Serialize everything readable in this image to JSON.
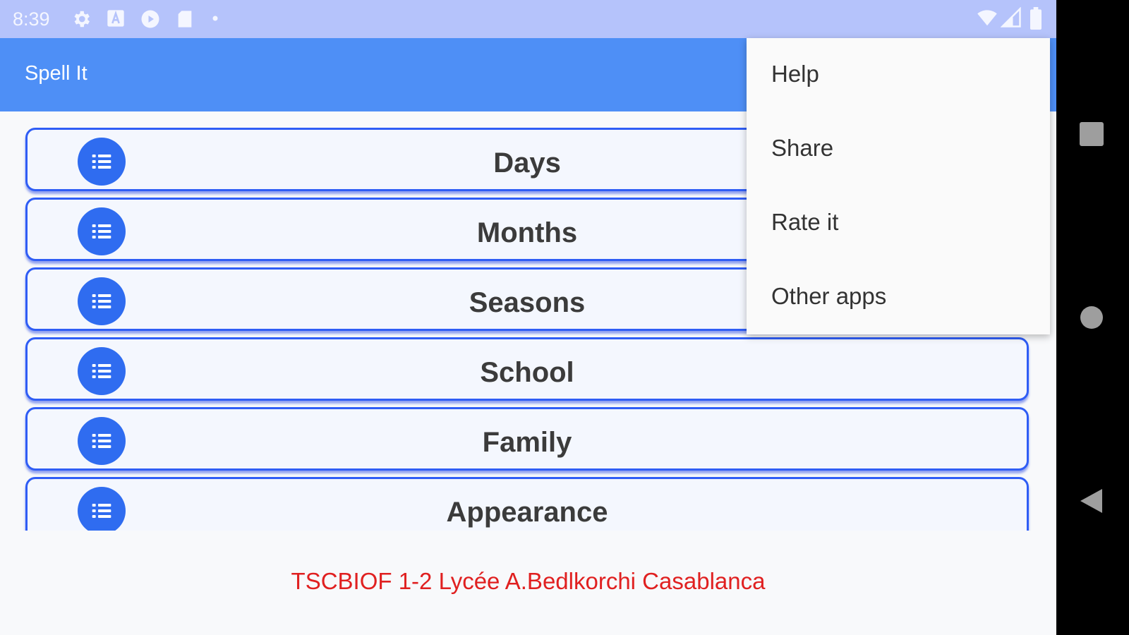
{
  "status_bar": {
    "time": "8:39",
    "left_icons": [
      "gear-icon",
      "a-box-icon",
      "play-icon",
      "sd-card-icon",
      "dot-icon"
    ],
    "right_icons": [
      "wifi-icon",
      "signal-icon",
      "battery-icon"
    ]
  },
  "app_bar": {
    "title": "Spell It"
  },
  "list": {
    "items": [
      {
        "label": "Days",
        "icon": "list-icon"
      },
      {
        "label": "Months",
        "icon": "list-icon"
      },
      {
        "label": "Seasons",
        "icon": "list-icon"
      },
      {
        "label": "School",
        "icon": "list-icon"
      },
      {
        "label": "Family",
        "icon": "list-icon"
      },
      {
        "label": "Appearance",
        "icon": "list-icon"
      }
    ]
  },
  "footer": {
    "credit": "TSCBIOF 1-2 Lycée A.Bedlkorchi Casablanca"
  },
  "overflow_menu": {
    "items": [
      {
        "label": "Help"
      },
      {
        "label": "Share"
      },
      {
        "label": "Rate it"
      },
      {
        "label": "Other apps"
      }
    ]
  },
  "nav_bar": {
    "buttons": [
      "recents-square-icon",
      "home-circle-icon",
      "back-triangle-icon"
    ]
  },
  "colors": {
    "status_bar": "#b5c3fb",
    "app_bar": "#4e8ff6",
    "item_border": "#2f5df5",
    "icon_circle": "#2f6cf0",
    "credit_text": "#e02020"
  }
}
